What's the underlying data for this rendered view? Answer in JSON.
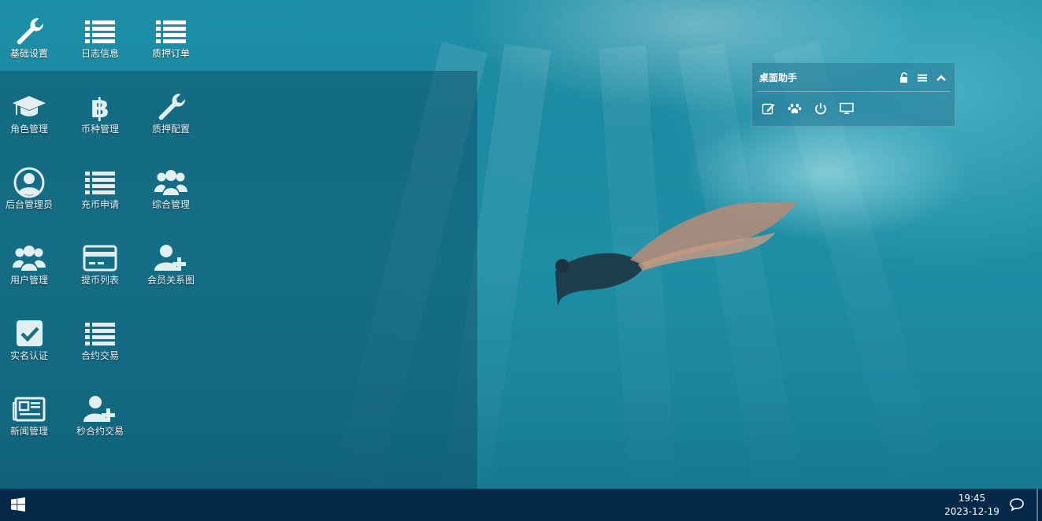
{
  "desktop_icons": [
    {
      "label": "基础设置",
      "icon": "wrench-icon"
    },
    {
      "label": "日志信息",
      "icon": "list-icon"
    },
    {
      "label": "质押订单",
      "icon": "list-icon"
    },
    {
      "label": "角色管理",
      "icon": "graduation-cap-icon"
    },
    {
      "label": "币种管理",
      "icon": "bitcoin-icon"
    },
    {
      "label": "质押配置",
      "icon": "wrench-icon"
    },
    {
      "label": "后台管理员",
      "icon": "user-circle-icon"
    },
    {
      "label": "充币申请",
      "icon": "list-icon"
    },
    {
      "label": "综合管理",
      "icon": "users-icon"
    },
    {
      "label": "用户管理",
      "icon": "users-icon"
    },
    {
      "label": "提币列表",
      "icon": "credit-card-icon"
    },
    {
      "label": "会员关系图",
      "icon": "user-plus-icon"
    },
    {
      "label": "实名认证",
      "icon": "check-square-icon"
    },
    {
      "label": "合约交易",
      "icon": "list-icon"
    },
    {
      "label": "新闻管理",
      "icon": "newspaper-icon"
    },
    {
      "label": "秒合约交易",
      "icon": "user-plus-icon"
    }
  ],
  "assistant": {
    "title": "桌面助手",
    "header_icons": [
      "unlock-icon",
      "menu-icon",
      "chevron-up-icon"
    ],
    "tools": [
      "edit-icon",
      "paw-icon",
      "power-icon",
      "monitor-icon"
    ]
  },
  "taskbar": {
    "time": "19:45",
    "date": "2023-12-19",
    "start_icon": "windows-icon",
    "notify_icon": "chat-bubble-icon"
  },
  "colors": {
    "taskbar": "#06294a",
    "panel": "rgba(10,70,95,0.45)",
    "water": "#1d8fa6"
  }
}
